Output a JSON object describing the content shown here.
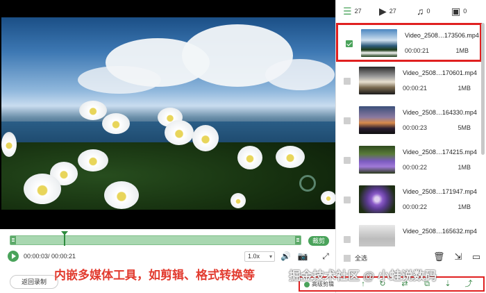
{
  "tabs": [
    {
      "icon": "list-icon",
      "count": "27"
    },
    {
      "icon": "video-icon",
      "count": "27"
    },
    {
      "icon": "music-icon",
      "count": "0"
    },
    {
      "icon": "image-icon",
      "count": "0"
    }
  ],
  "files": [
    {
      "name": "Video_2508…173506.mp4",
      "duration": "00:00:21",
      "size": "1MB",
      "checked": true,
      "thumb": "flowers-sea"
    },
    {
      "name": "Video_2508…170601.mp4",
      "duration": "00:00:21",
      "size": "1MB",
      "checked": false,
      "thumb": "birds-sunset"
    },
    {
      "name": "Video_2508…164330.mp4",
      "duration": "00:00:23",
      "size": "5MB",
      "checked": false,
      "thumb": "city-dusk"
    },
    {
      "name": "Video_2508…174215.mp4",
      "duration": "00:00:22",
      "size": "1MB",
      "checked": false,
      "thumb": "purple-flowers"
    },
    {
      "name": "Video_2508…171947.mp4",
      "duration": "00:00:22",
      "size": "1MB",
      "checked": false,
      "thumb": "purple-bloom"
    },
    {
      "name": "Video_2508…165632.mp4",
      "duration": "",
      "size": "",
      "checked": false,
      "thumb": "butterfly"
    }
  ],
  "player": {
    "time": "00:00:03/ 00:00:21",
    "speed": "1.0x",
    "cut_label": "裁剪",
    "back_label": "返回录制"
  },
  "panel": {
    "select_all": "全选"
  },
  "toolbar": {
    "chip_label": "高级剪辑"
  },
  "overlay": {
    "caption": "内嵌多媒体工具，如剪辑、格式转换等",
    "watermark": "掘金技术社区 @ 小蛙说数码"
  },
  "colors": {
    "accent": "#4aa35b",
    "highlight": "#e02020"
  }
}
